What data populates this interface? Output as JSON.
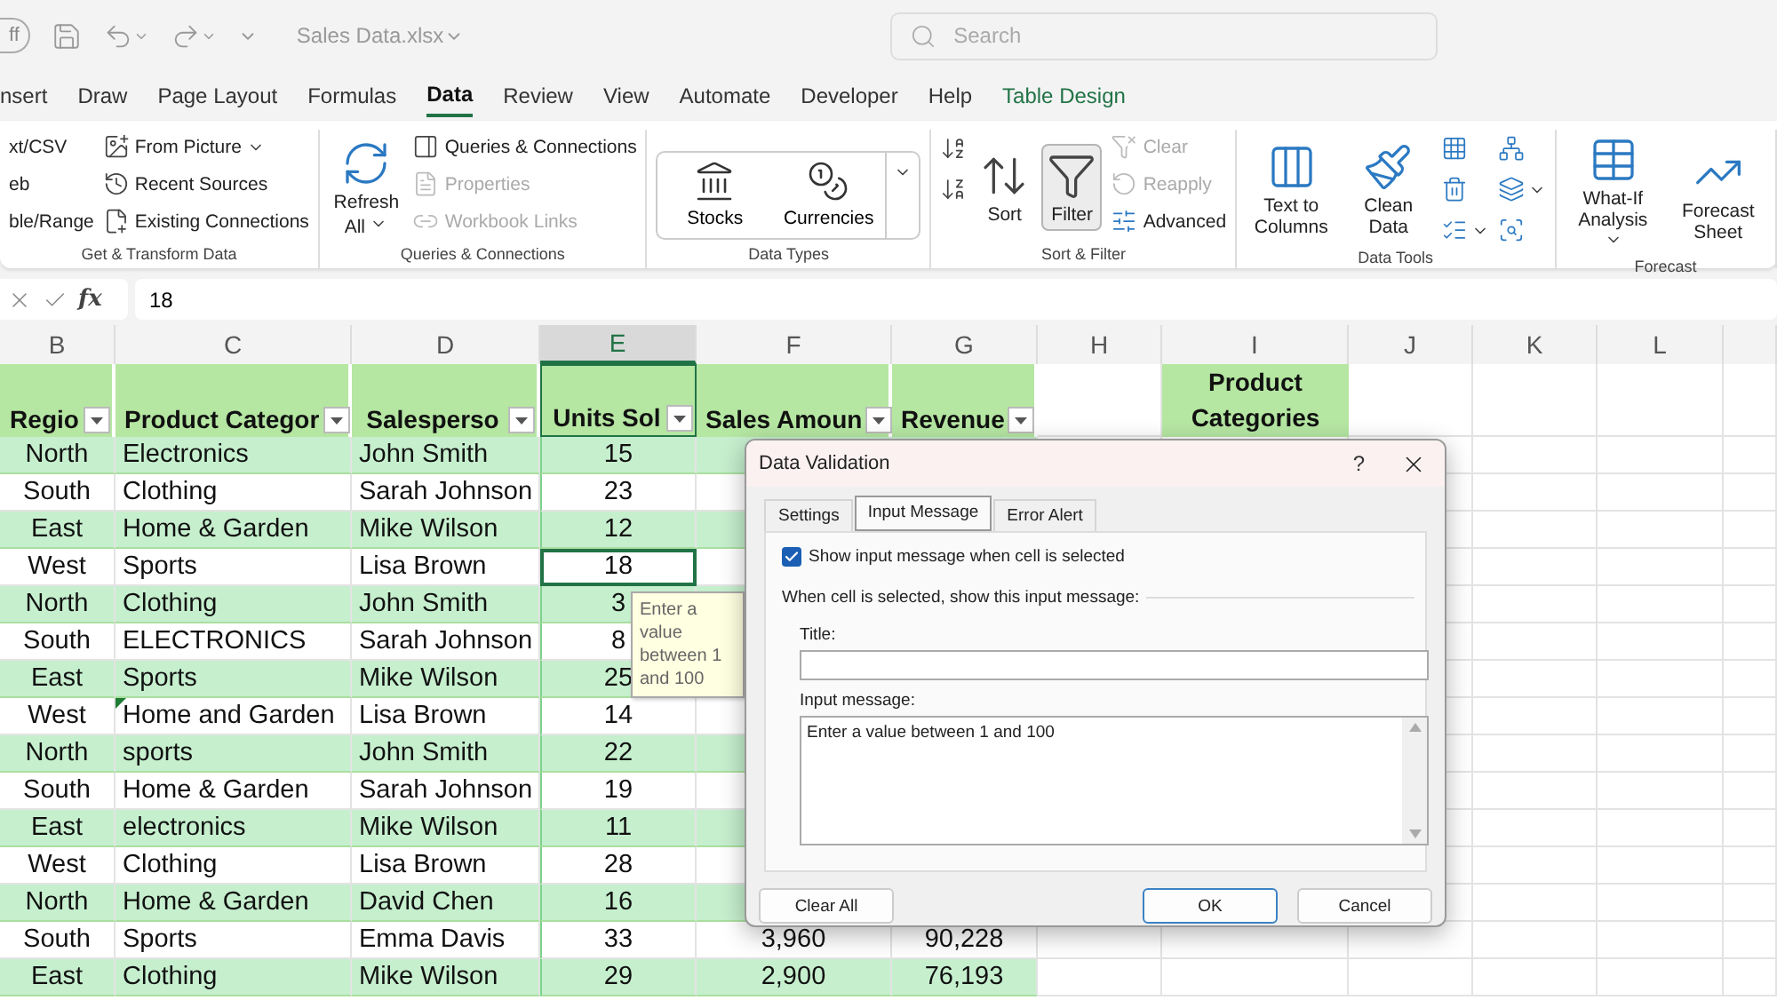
{
  "title_bar": {
    "autosave": "ff",
    "file_name": "Sales Data.xlsx",
    "search_placeholder": "Search"
  },
  "tabs": [
    {
      "label": "nsert",
      "selected": false,
      "kind": "normal"
    },
    {
      "label": "Draw",
      "selected": false,
      "kind": "normal"
    },
    {
      "label": "Page Layout",
      "selected": false,
      "kind": "normal"
    },
    {
      "label": "Formulas",
      "selected": false,
      "kind": "normal"
    },
    {
      "label": "Data",
      "selected": true,
      "kind": "normal"
    },
    {
      "label": "Review",
      "selected": false,
      "kind": "normal"
    },
    {
      "label": "View",
      "selected": false,
      "kind": "normal"
    },
    {
      "label": "Automate",
      "selected": false,
      "kind": "normal"
    },
    {
      "label": "Developer",
      "selected": false,
      "kind": "normal"
    },
    {
      "label": "Help",
      "selected": false,
      "kind": "normal"
    },
    {
      "label": "Table Design",
      "selected": false,
      "kind": "contextual"
    }
  ],
  "ribbon": {
    "groups": [
      {
        "label": "Get & Transform Data",
        "columns": [
          {
            "items": [
              {
                "kind": "small",
                "label": "xt/CSV",
                "disabled": false,
                "dropdown": false
              },
              {
                "kind": "small",
                "label": "eb",
                "disabled": false,
                "dropdown": false
              },
              {
                "kind": "small",
                "label": "ble/Range",
                "disabled": false,
                "dropdown": false
              }
            ]
          },
          {
            "items": [
              {
                "kind": "small",
                "label": "From Picture",
                "disabled": false,
                "dropdown": true
              },
              {
                "kind": "small",
                "label": "Recent Sources",
                "disabled": false,
                "dropdown": false
              },
              {
                "kind": "small",
                "label": "Existing Connections",
                "disabled": false,
                "dropdown": false
              }
            ]
          }
        ]
      },
      {
        "label": "Queries & Connections",
        "columns": [
          {
            "items": [
              {
                "kind": "large",
                "label": "Refresh All",
                "disabled": false,
                "dropdown": true,
                "pressed": false
              }
            ]
          },
          {
            "items": [
              {
                "kind": "small",
                "label": "Queries & Connections",
                "disabled": false,
                "dropdown": false
              },
              {
                "kind": "small",
                "label": "Properties",
                "disabled": true,
                "dropdown": false
              },
              {
                "kind": "small",
                "label": "Workbook Links",
                "disabled": true,
                "dropdown": false
              }
            ]
          }
        ]
      },
      {
        "label": "Data Types",
        "columns": [
          {
            "items": [
              {
                "kind": "gallery",
                "entries": [
                  "Stocks",
                  "Currencies"
                ]
              }
            ]
          }
        ]
      },
      {
        "label": "Sort & Filter",
        "columns": [
          {
            "items": [
              {
                "kind": "icon",
                "dropdown": false
              },
              {
                "kind": "icon",
                "dropdown": false
              }
            ]
          },
          {
            "items": [
              {
                "kind": "large",
                "label": "Sort",
                "disabled": false,
                "dropdown": false,
                "pressed": false
              }
            ]
          },
          {
            "items": [
              {
                "kind": "large",
                "label": "Filter",
                "disabled": false,
                "dropdown": false,
                "pressed": true
              }
            ]
          },
          {
            "items": [
              {
                "kind": "small",
                "label": "Clear",
                "disabled": true,
                "dropdown": false
              },
              {
                "kind": "small",
                "label": "Reapply",
                "disabled": true,
                "dropdown": false
              },
              {
                "kind": "small",
                "label": "Advanced",
                "disabled": false,
                "dropdown": false
              }
            ]
          }
        ]
      },
      {
        "label": "Data Tools",
        "columns": [
          {
            "items": [
              {
                "kind": "large",
                "label": "Text to Columns",
                "disabled": false,
                "dropdown": false,
                "pressed": false
              }
            ]
          },
          {
            "items": [
              {
                "kind": "large",
                "label": "Clean Data",
                "disabled": false,
                "dropdown": false,
                "pressed": false
              }
            ]
          },
          {
            "items": [
              {
                "kind": "icon",
                "dropdown": false
              },
              {
                "kind": "icon",
                "dropdown": false
              },
              {
                "kind": "icon",
                "dropdown": true
              }
            ]
          },
          {
            "items": [
              {
                "kind": "icon",
                "dropdown": false
              },
              {
                "kind": "icon",
                "dropdown": true
              },
              {
                "kind": "icon",
                "dropdown": false
              }
            ]
          }
        ]
      },
      {
        "label": "Forecast",
        "columns": [
          {
            "items": [
              {
                "kind": "large",
                "label": "What-If Analysis",
                "disabled": false,
                "dropdown": true,
                "pressed": false
              }
            ]
          },
          {
            "items": [
              {
                "kind": "large",
                "label": "Forecast Sheet",
                "disabled": false,
                "dropdown": false,
                "pressed": false
              }
            ]
          }
        ]
      }
    ]
  },
  "formula_bar": {
    "fx_label": "fx",
    "value": "18"
  },
  "columns": [
    {
      "letter": "B",
      "selected": false
    },
    {
      "letter": "C",
      "selected": false
    },
    {
      "letter": "D",
      "selected": false
    },
    {
      "letter": "E",
      "selected": true
    },
    {
      "letter": "F",
      "selected": false
    },
    {
      "letter": "G",
      "selected": false
    },
    {
      "letter": "H",
      "selected": false
    },
    {
      "letter": "I",
      "selected": false
    },
    {
      "letter": "J",
      "selected": false
    },
    {
      "letter": "K",
      "selected": false
    },
    {
      "letter": "L",
      "selected": false
    }
  ],
  "table": {
    "headers": [
      "Regio",
      "Product Categor",
      "Salesperso",
      "Units Sol",
      "Sales Amoun",
      "Revenue"
    ],
    "side_header": "Product Categories",
    "rows": [
      {
        "region": "North",
        "category": "Electronics",
        "salesperson": "John Smith",
        "units": "15",
        "selected": false,
        "flagged": false
      },
      {
        "region": "South",
        "category": "Clothing",
        "salesperson": "Sarah Johnson",
        "units": "23",
        "selected": false,
        "flagged": false
      },
      {
        "region": "East",
        "category": "Home & Garden",
        "salesperson": "Mike Wilson",
        "units": "12",
        "selected": false,
        "flagged": false
      },
      {
        "region": "West",
        "category": "Sports",
        "salesperson": "Lisa Brown",
        "units": "18",
        "selected": true,
        "flagged": false
      },
      {
        "region": "North",
        "category": "Clothing",
        "salesperson": "John Smith",
        "units": "3",
        "selected": false,
        "flagged": false
      },
      {
        "region": "South",
        "category": "ELECTRONICS",
        "salesperson": "Sarah Johnson",
        "units": "8",
        "selected": false,
        "flagged": false
      },
      {
        "region": "East",
        "category": "Sports",
        "salesperson": "Mike Wilson",
        "units": "25",
        "selected": false,
        "flagged": false
      },
      {
        "region": "West",
        "category": "Home and Garden",
        "salesperson": "Lisa Brown",
        "units": "14",
        "selected": false,
        "flagged": true
      },
      {
        "region": "North",
        "category": "sports",
        "salesperson": "John Smith",
        "units": "22",
        "selected": false,
        "flagged": false
      },
      {
        "region": "South",
        "category": "Home & Garden",
        "salesperson": "Sarah Johnson",
        "units": "19",
        "selected": false,
        "flagged": false
      },
      {
        "region": "East",
        "category": "electronics",
        "salesperson": "Mike Wilson",
        "units": "11",
        "selected": false,
        "flagged": false
      },
      {
        "region": "West",
        "category": "Clothing",
        "salesperson": "Lisa Brown",
        "units": "28",
        "selected": false,
        "flagged": false
      },
      {
        "region": "North",
        "category": "Home & Garden",
        "salesperson": "David Chen",
        "units": "16",
        "selected": false,
        "flagged": false
      },
      {
        "region": "South",
        "category": "Sports",
        "salesperson": "Emma Davis",
        "units": "33",
        "amount": "3,960",
        "revenue": "90,228",
        "selected": false,
        "flagged": false
      },
      {
        "region": "East",
        "category": "Clothing",
        "salesperson": "Mike Wilson",
        "units": "29",
        "amount": "2,900",
        "revenue": "76,193",
        "selected": false,
        "flagged": false
      }
    ]
  },
  "tooltip": "Enter a value between 1 and 100",
  "dialog": {
    "title": "Data Validation",
    "help": "?",
    "tabs": [
      {
        "label": "Settings",
        "selected": false
      },
      {
        "label": "Input Message",
        "selected": true
      },
      {
        "label": "Error Alert",
        "selected": false
      }
    ],
    "checkbox": {
      "label": "Show input message when cell is selected",
      "checked": true
    },
    "section": "When cell is selected, show this input message:",
    "title_label": "Title:",
    "message_label": "Input message:",
    "message": "Enter a value between 1 and 100",
    "buttons": [
      {
        "label": "Clear All",
        "kind": "left"
      },
      {
        "label": "OK",
        "kind": "default"
      },
      {
        "label": "Cancel",
        "kind": "normal"
      }
    ]
  }
}
